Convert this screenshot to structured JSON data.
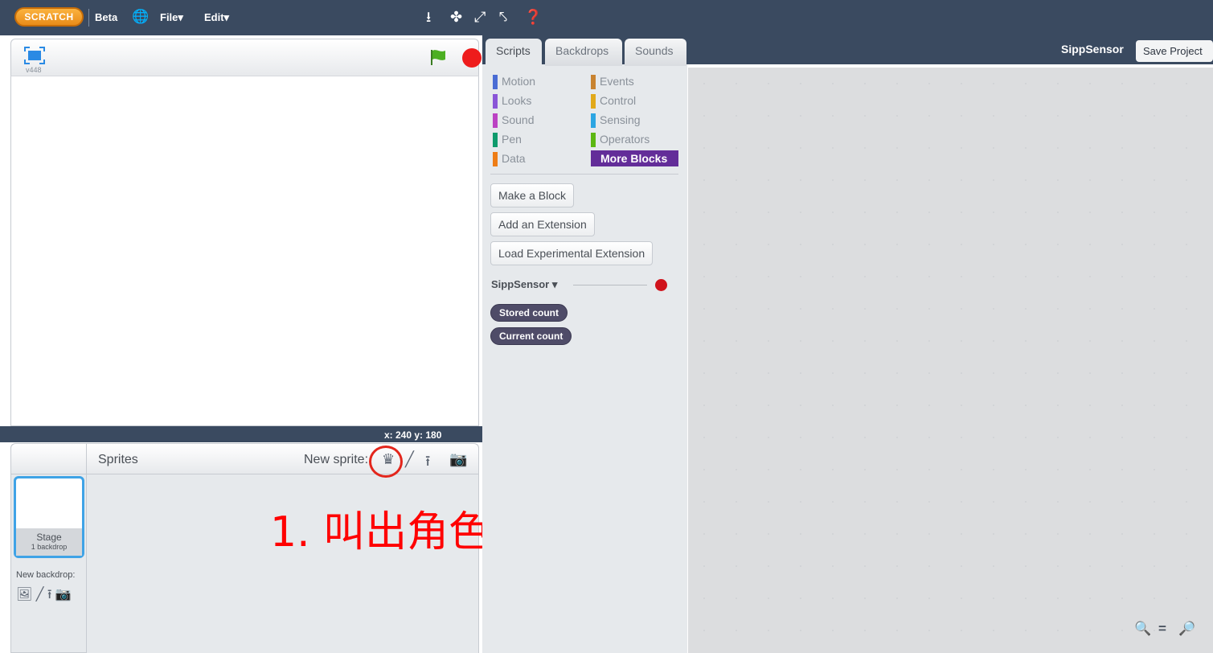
{
  "menubar": {
    "logo": "SCRATCH",
    "beta": "Beta",
    "file": "File▾",
    "edit": "Edit▾"
  },
  "stage": {
    "version": "v448",
    "coords": "x: 240  y: 180"
  },
  "sprites": {
    "label": "Sprites",
    "new_sprite": "New sprite:",
    "stage_thumb_title": "Stage",
    "stage_thumb_sub": "1 backdrop",
    "new_backdrop": "New backdrop:"
  },
  "tabs": [
    {
      "label": "Scripts",
      "active": true
    },
    {
      "label": "Backdrops",
      "active": false
    },
    {
      "label": "Sounds",
      "active": false
    }
  ],
  "categories": {
    "left": [
      {
        "label": "Motion",
        "color": "#4a6cd4"
      },
      {
        "label": "Looks",
        "color": "#8a55d7"
      },
      {
        "label": "Sound",
        "color": "#bb42c3"
      },
      {
        "label": "Pen",
        "color": "#0e9a6c"
      },
      {
        "label": "Data",
        "color": "#ee7d16"
      }
    ],
    "right": [
      {
        "label": "Events",
        "color": "#c88330"
      },
      {
        "label": "Control",
        "color": "#e1a91a"
      },
      {
        "label": "Sensing",
        "color": "#2ca5e2"
      },
      {
        "label": "Operators",
        "color": "#5cb712"
      },
      {
        "label": "More Blocks",
        "color": "#632d99"
      }
    ]
  },
  "palette": {
    "make_block": "Make a Block",
    "add_extension": "Add an Extension",
    "load_experimental": "Load Experimental Extension",
    "extension_name": "SippSensor ▾",
    "reporters": [
      "Stored count",
      "Current count"
    ]
  },
  "header": {
    "project_title": "SippSensor",
    "save_project": "Save Project"
  },
  "annotation": {
    "text": "1. 叫出角色",
    "color": "#ff0000"
  }
}
